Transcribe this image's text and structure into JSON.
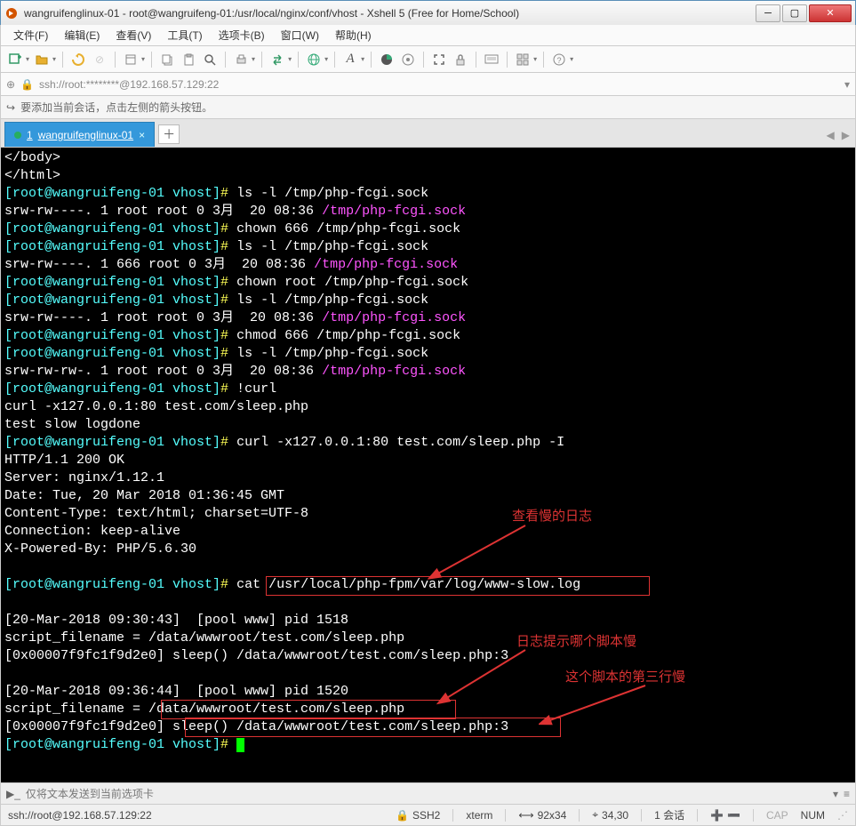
{
  "window": {
    "title": "wangruifenglinux-01 - root@wangruifeng-01:/usr/local/nginx/conf/vhost - Xshell 5 (Free for Home/School)"
  },
  "menu": {
    "file": "文件(F)",
    "edit": "编辑(E)",
    "view": "查看(V)",
    "tools": "工具(T)",
    "tabs": "选项卡(B)",
    "window": "窗口(W)",
    "help": "帮助(H)"
  },
  "address": {
    "text": "ssh://root:********@192.168.57.129:22"
  },
  "hint": {
    "text": "要添加当前会话，点击左侧的箭头按钮。"
  },
  "tab": {
    "index": "1",
    "label": "wangruifenglinux-01",
    "add": "＋"
  },
  "terminal": {
    "l1": "</body>",
    "l2": "</html>",
    "pr_open": "[root@wangruifeng-01 vhost]",
    "hash": "# ",
    "cmd_ls": "ls -l /tmp/php-fcgi.sock",
    "perm1": "srw-rw----. 1 root root 0 3月  20 08:36 ",
    "sock": "/tmp/php-fcgi.sock",
    "cmd_chown666": "chown 666 /tmp/php-fcgi.sock",
    "perm2": "srw-rw----. 1 666 root 0 3月  20 08:36 ",
    "cmd_chownroot": "chown root /tmp/php-fcgi.sock",
    "cmd_chmod666": "chmod 666 /tmp/php-fcgi.sock",
    "perm3": "srw-rw-rw-. 1 root root 0 3月  20 08:36 ",
    "cmd_curl": "!curl",
    "curl_cmd": "curl -x127.0.0.1:80 test.com/sleep.php",
    "curl_out": "test slow logdone",
    "cmd_curlI": "curl -x127.0.0.1:80 test.com/sleep.php -I",
    "h1": "HTTP/1.1 200 OK",
    "h2": "Server: nginx/1.12.1",
    "h3": "Date: Tue, 20 Mar 2018 01:36:45 GMT",
    "h4": "Content-Type: text/html; charset=UTF-8",
    "h5": "Connection: keep-alive",
    "h6": "X-Powered-By: PHP/5.6.30",
    "cmd_cat": "cat /usr/local/php-fpm/var/log/www-slow.log",
    "log1": "[20-Mar-2018 09:30:43]  [pool www] pid 1518",
    "log2": "script_filename = /data/wwwroot/test.com/sleep.php",
    "log3": "[0x00007f9fc1f9d2e0] sleep() /data/wwwroot/test.com/sleep.php:3",
    "log4": "[20-Mar-2018 09:36:44]  [pool www] pid 1520",
    "log5a": "script_filename = ",
    "log5b": "/data/wwwroot/test.com/sleep.php",
    "log6a": "[0x00007f9fc1f9d2e0] ",
    "log6b": "sleep() /data/wwwroot/test.com/sleep.php:3"
  },
  "annotations": {
    "a1": "查看慢的日志",
    "a2": "日志提示哪个脚本慢",
    "a3": "这个脚本的第三行慢"
  },
  "sendbar": {
    "text": "仅将文本发送到当前选项卡"
  },
  "status": {
    "left": "ssh://root@192.168.57.129:22",
    "ssh": "SSH2",
    "term": "xterm",
    "size": "92x34",
    "pos": "34,30",
    "sessions": "1 会话",
    "cap": "CAP",
    "num": "NUM"
  }
}
